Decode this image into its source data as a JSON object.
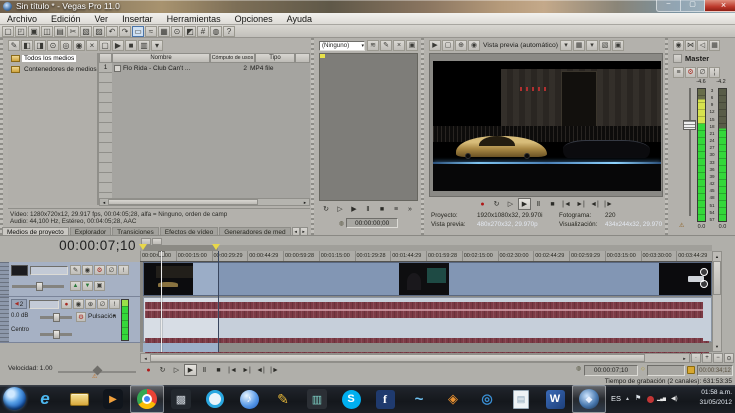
{
  "window": {
    "title": "Sin título * - Vegas Pro 11.0",
    "controls": {
      "minimize": "–",
      "maximize": "▢",
      "close": "×"
    }
  },
  "menubar": {
    "items": [
      "Archivo",
      "Edición",
      "Ver",
      "Insertar",
      "Herramientas",
      "Opciones",
      "Ayuda"
    ]
  },
  "toolbar": {
    "icons": [
      {
        "name": "new-project-button",
        "glyph": "▢"
      },
      {
        "name": "open-button",
        "glyph": "◰"
      },
      {
        "name": "save-button",
        "glyph": "▣"
      },
      {
        "name": "render-as-button",
        "glyph": "◫"
      },
      {
        "name": "project-properties-button",
        "glyph": "▤"
      },
      {
        "name": "cut-button",
        "glyph": "✂"
      },
      {
        "name": "copy-button",
        "glyph": "▧"
      },
      {
        "name": "paste-button",
        "glyph": "▨"
      },
      {
        "name": "undo-button",
        "glyph": "↶"
      },
      {
        "name": "redo-button",
        "glyph": "↷"
      },
      {
        "name": "normal-edit-tool-button",
        "glyph": "▭",
        "active": true
      },
      {
        "name": "envelope-edit-tool-button",
        "glyph": "≈"
      },
      {
        "name": "selection-edit-tool-button",
        "glyph": "▦"
      },
      {
        "name": "zoom-edit-tool-button",
        "glyph": "⊙"
      },
      {
        "name": "trimmer-button",
        "glyph": "◩"
      },
      {
        "name": "snapping-button",
        "glyph": "#"
      },
      {
        "name": "interactive-tutorials-button",
        "glyph": "◍"
      },
      {
        "name": "help-button",
        "glyph": "?"
      }
    ]
  },
  "media_panel": {
    "toolbar_icons": [
      {
        "name": "media-properties-button",
        "glyph": "✎"
      },
      {
        "name": "media-fx-button",
        "glyph": "◧"
      },
      {
        "name": "import-media-button",
        "glyph": "◨"
      },
      {
        "name": "capture-video-button",
        "glyph": "⊙"
      },
      {
        "name": "get-media-from-web-button",
        "glyph": "◎"
      },
      {
        "name": "search-media-button",
        "glyph": "◉"
      },
      {
        "name": "remove-media-button",
        "glyph": "×"
      },
      {
        "name": "new-bin-button",
        "glyph": "▢"
      },
      {
        "name": "start-preview-button",
        "glyph": "▶"
      },
      {
        "name": "stop-preview-button",
        "glyph": "■"
      },
      {
        "name": "views-button",
        "glyph": "▥"
      },
      {
        "name": "more-button",
        "glyph": "▾"
      }
    ],
    "tree": [
      {
        "label": "Todos los medios",
        "selected": true
      },
      {
        "label": "Contenedores de medios",
        "selected": false
      }
    ],
    "table": {
      "columns": [
        "Nombre",
        "Cómputo de usos",
        "Tipo"
      ],
      "rows": [
        {
          "num": "1",
          "name": "Flo Rida - Club Can't ...",
          "usage": "2",
          "type": "MP4 file"
        }
      ]
    },
    "info": {
      "video": "Vídeo: 1280x720x12, 29.917 fps, 00:04:05;28, alfa = Ninguno, orden de camp",
      "audio": "Audio: 44,100 Hz, Estéreo, 00:04:05;28, AAC"
    },
    "tabs": [
      {
        "label": "Medios de proyecto",
        "active": true
      },
      {
        "label": "Explorador"
      },
      {
        "label": "Transiciones"
      },
      {
        "label": "Efectos de vídeo"
      },
      {
        "label": "Generadores de med"
      }
    ]
  },
  "trimmer": {
    "plugin_dropdown": "(Ninguno)",
    "toolbar_icons": [
      {
        "name": "trimmer-history-button",
        "glyph": "≋"
      },
      {
        "name": "edit-media-button",
        "glyph": "✎"
      },
      {
        "name": "close-media-button",
        "glyph": "×"
      },
      {
        "name": "monitor-button",
        "glyph": "▣"
      }
    ],
    "transport": [
      {
        "name": "loop-playback-button",
        "glyph": "↻"
      },
      {
        "name": "play-from-start-button",
        "glyph": "▷"
      },
      {
        "name": "play-button",
        "glyph": "▶"
      },
      {
        "name": "pause-button",
        "glyph": "Ⅱ"
      },
      {
        "name": "stop-button",
        "glyph": "■"
      },
      {
        "name": "options-button",
        "glyph": "≡"
      },
      {
        "name": "more-button",
        "glyph": "»"
      }
    ],
    "timecode": "00:00:00;00"
  },
  "preview": {
    "toolbar_icons_left": [
      {
        "name": "video-output-fx-button",
        "glyph": "▶"
      },
      {
        "name": "external-monitor-button",
        "glyph": "▢"
      },
      {
        "name": "video-overlay-button",
        "glyph": "⊕"
      },
      {
        "name": "quality-swatch-button",
        "glyph": "◉"
      }
    ],
    "quality_label": "Vista previa (automático)",
    "toolbar_icons_right": [
      {
        "name": "dropdown-arrow-icon",
        "glyph": "▾"
      },
      {
        "name": "grid-overlay-button",
        "glyph": "▦"
      },
      {
        "name": "overlay-dropdown-arrow-icon",
        "glyph": "▾"
      },
      {
        "name": "copy-snapshot-button",
        "glyph": "▧"
      },
      {
        "name": "save-snapshot-button",
        "glyph": "▣"
      }
    ],
    "transport": [
      {
        "name": "record-button",
        "glyph": "●",
        "red": true
      },
      {
        "name": "loop-playback-button",
        "glyph": "↻"
      },
      {
        "name": "play-from-start-button",
        "glyph": "▷"
      },
      {
        "name": "play-button",
        "glyph": "▶",
        "active": true
      },
      {
        "name": "pause-button",
        "glyph": "Ⅱ"
      },
      {
        "name": "stop-button",
        "glyph": "■"
      },
      {
        "name": "go-to-start-button",
        "glyph": "|◄"
      },
      {
        "name": "go-to-end-button",
        "glyph": "►|"
      },
      {
        "name": "previous-frame-button",
        "glyph": "◄|"
      },
      {
        "name": "next-frame-button",
        "glyph": "|►"
      }
    ],
    "status": {
      "project_label": "Proyecto:",
      "project": "1920x1080x32, 29.970i",
      "preview_label": "Vista previa:",
      "preview": "480x270x32, 29.970p",
      "frame_label": "Fotograma:",
      "frame": "220",
      "display_label": "Visualización:",
      "display": "434x244x32, 29.970"
    }
  },
  "master": {
    "toolbar_icons": [
      {
        "name": "downmix-output-button",
        "glyph": "◉"
      },
      {
        "name": "dim-output-button",
        "glyph": "⋈"
      },
      {
        "name": "mute-output-button",
        "glyph": "◁"
      },
      {
        "name": "mixer-layout-button",
        "glyph": "▦"
      }
    ],
    "label": "Master",
    "channel_icons": [
      {
        "name": "insert-fx-button",
        "glyph": "≡"
      },
      {
        "name": "master-fx-button",
        "glyph": "⚙",
        "red": true
      },
      {
        "name": "mute-button",
        "glyph": "∅"
      },
      {
        "name": "solo-button",
        "glyph": "¦"
      }
    ],
    "peak_left": "-4.6",
    "peak_right": "-4.2",
    "scale": [
      "3",
      "6",
      "9",
      "12",
      "15",
      "18",
      "21",
      "24",
      "27",
      "30",
      "33",
      "36",
      "39",
      "42",
      "45",
      "48",
      "51",
      "54",
      "57"
    ],
    "gain_left": "0.0",
    "gain_right": "0.0"
  },
  "timeline": {
    "current_timecode": "00:00:07;10",
    "ruler_ticks": [
      "00:00:00:00",
      "00:00:15:00",
      "00:00:29:29",
      "00:00:44:29",
      "00:00:59:28",
      "00:01:15:00",
      "00:01:29:28",
      "00:01:44:29",
      "00:01:59:28",
      "00:02:15:00",
      "00:02:30:00",
      "00:02:44:29",
      "00:02:59:29",
      "00:03:15:00",
      "00:03:30:00",
      "00:03:44:29"
    ],
    "video_track": {
      "icons": [
        {
          "name": "track-name-edit-button",
          "glyph": "✎"
        },
        {
          "name": "track-motion-button",
          "glyph": "◉"
        },
        {
          "name": "track-fx-button",
          "glyph": "⚙",
          "red": true
        },
        {
          "name": "mute-track-button",
          "glyph": "∅"
        },
        {
          "name": "solo-track-button",
          "glyph": "!"
        }
      ]
    },
    "audio_track": {
      "number": "2",
      "icons": [
        {
          "name": "arm-record-button",
          "glyph": "●",
          "red": true
        },
        {
          "name": "invert-phase-button",
          "glyph": "◉"
        },
        {
          "name": "track-fx-button",
          "glyph": "⊕"
        },
        {
          "name": "mute-track-button",
          "glyph": "∅"
        },
        {
          "name": "solo-track-button",
          "glyph": "!"
        }
      ],
      "volume": "0.0 dB",
      "pan_label": "Centro",
      "mode": "Pulsación"
    },
    "rate_label": "Velocidad: 1.00",
    "transport": [
      {
        "name": "record-button",
        "glyph": "●",
        "red": true
      },
      {
        "name": "loop-playback-button",
        "glyph": "↻"
      },
      {
        "name": "play-from-start-button",
        "glyph": "▷"
      },
      {
        "name": "play-button",
        "glyph": "▶",
        "active": true
      },
      {
        "name": "pause-button",
        "glyph": "Ⅱ"
      },
      {
        "name": "stop-button",
        "glyph": "■"
      },
      {
        "name": "go-to-start-button",
        "glyph": "|◄"
      },
      {
        "name": "go-to-end-button",
        "glyph": "►|"
      },
      {
        "name": "previous-frame-button",
        "glyph": "◄|"
      },
      {
        "name": "next-frame-button",
        "glyph": "|►"
      }
    ],
    "cursor_field": "00:00:07;10",
    "selection_start_field": "",
    "selection_end_field": "00:00:34;12",
    "recording_time": "Tiempo de grabación (2 canales): 631:53:35"
  },
  "taskbar": {
    "items": [
      {
        "name": "taskbar-internet-explorer-button",
        "cls": "ie",
        "glyph": "e"
      },
      {
        "name": "taskbar-windows-explorer-button",
        "cls": "explorer",
        "glyph": ""
      },
      {
        "name": "taskbar-media-player-button",
        "cls": "wmp",
        "glyph": "▶"
      },
      {
        "name": "taskbar-chrome-button",
        "cls": "chrome",
        "glyph": "",
        "active": true
      },
      {
        "name": "taskbar-media-player-classic-button",
        "cls": "mpc",
        "glyph": "▩"
      },
      {
        "name": "taskbar-quicktime-button",
        "cls": "qt",
        "glyph": "Q"
      },
      {
        "name": "taskbar-itunes-button",
        "cls": "itunes",
        "glyph": "♪"
      },
      {
        "name": "taskbar-winamp-button",
        "cls": "winamp",
        "glyph": "✎"
      },
      {
        "name": "taskbar-movie-maker-button",
        "cls": "mm",
        "glyph": "▥"
      },
      {
        "name": "taskbar-skype-button",
        "cls": "skype",
        "glyph": "S"
      },
      {
        "name": "taskbar-facebook-button",
        "cls": "fb",
        "glyph": "f"
      },
      {
        "name": "taskbar-messenger-button",
        "cls": "msn",
        "glyph": "~"
      },
      {
        "name": "taskbar-picasa-button",
        "cls": "picasa",
        "glyph": "◈"
      },
      {
        "name": "taskbar-swirl-app-button",
        "cls": "swirl",
        "glyph": "◎"
      },
      {
        "name": "taskbar-notepad-button",
        "cls": "notepad",
        "glyph": "▤"
      },
      {
        "name": "taskbar-word-button",
        "cls": "word",
        "glyph": "W"
      },
      {
        "name": "taskbar-vegas-pro-button",
        "cls": "vegas",
        "glyph": "◆",
        "active": true
      }
    ],
    "tray": {
      "lang": "ES",
      "time": "01:58 a.m.",
      "date": "31/05/2012"
    }
  }
}
